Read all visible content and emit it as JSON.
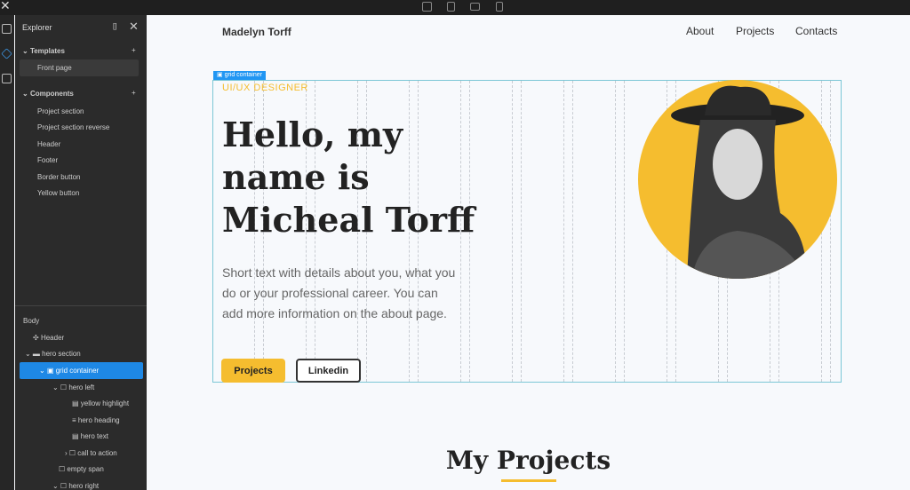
{
  "toolbar": {
    "devices": [
      "desktop-icon",
      "tablet-icon",
      "tablet-landscape-icon",
      "mobile-icon"
    ]
  },
  "explorer": {
    "title": "Explorer",
    "templates_label": "Templates",
    "templates": [
      "Front page"
    ],
    "components_label": "Components",
    "components": [
      "Project section",
      "Project section reverse",
      "Header",
      "Footer",
      "Border button",
      "Yellow button"
    ],
    "tree": [
      {
        "label": "Body"
      },
      {
        "label": "Header"
      },
      {
        "label": "hero section"
      },
      {
        "label": "grid container"
      },
      {
        "label": "hero left"
      },
      {
        "label": "yellow highlight"
      },
      {
        "label": "hero heading"
      },
      {
        "label": "hero text"
      },
      {
        "label": "call to action"
      },
      {
        "label": "empty span"
      },
      {
        "label": "hero right"
      }
    ]
  },
  "site": {
    "brand": "Madelyn Torff",
    "nav": [
      "About",
      "Projects",
      "Contacts"
    ],
    "selection_tag": "grid container",
    "highlight": "UI/UX DESIGNER",
    "heading": "Hello, my name is Micheal Torff",
    "text": "Short text with details about you, what you do or your professional career. You can add more information on the about page.",
    "btn_primary": "Projects",
    "btn_secondary": "Linkedin",
    "section_title": "My Projects",
    "colors": {
      "accent": "#f5bd2f",
      "selection": "#2196f3"
    }
  }
}
